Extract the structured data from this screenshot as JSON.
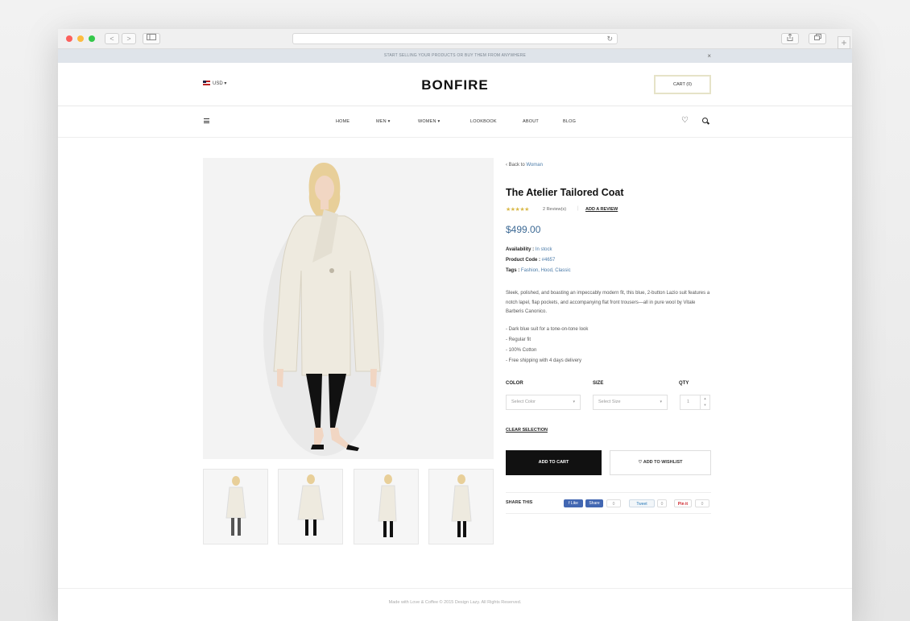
{
  "browser": {
    "buttons": [
      "<",
      ">"
    ]
  },
  "banner": {
    "text": "START SELLING YOUR PRODUCTS OR BUY THEM FROM ANYWHERE",
    "close": "×"
  },
  "header": {
    "currency": "USD",
    "logo": "BONFIRE",
    "cart": "CART (0)"
  },
  "nav": {
    "items": [
      "HOME",
      "MEN",
      "WOMEN",
      "LOOKBOOK",
      "ABOUT",
      "BLOG"
    ]
  },
  "product": {
    "breadcrumb_prefix": "‹ Back to ",
    "breadcrumb_link": "Woman",
    "title": "The Atelier Tailored Coat",
    "stars": "★★★★★",
    "reviews": "2 Review(s)",
    "separator": "|",
    "add_review": "ADD A REVIEW",
    "price": "$499.00",
    "availability_label": "Availability :",
    "availability_value": "In stock",
    "code_label": "Product Code :",
    "code_value": "#4657",
    "tags_label": "Tags :",
    "tags_value": "Fashion, Hood, Classic",
    "description": "Sleek, polished, and boasting an impeccably modern fit, this blue, 2-button Lazio suit features a notch lapel, flap pockets, and accompanying flat front trousers—all in pure wool by Vitale Barberis Canonico.",
    "bullets": [
      "-  Dark blue suit for a tone-on-tone look",
      "-  Regular fit",
      "-  100% Cotton",
      "-  Free shipping with 4 days delivery"
    ],
    "color_label": "COLOR",
    "size_label": "SIZE",
    "qty_label": "QTY",
    "color_placeholder": "Select Color",
    "size_placeholder": "Select Size",
    "qty_value": "1",
    "clear_selection": "CLEAR SELECTION",
    "add_to_cart": "ADD TO CART",
    "add_to_wishlist": "ADD TO WISHLIST",
    "share_label": "SHARE THIS",
    "share": {
      "like": "f Like",
      "fb_share": "Share",
      "fb_count": "0",
      "tweet": "Tweet",
      "tw_count": "0",
      "pin": "Pin it",
      "pin_count": "0"
    }
  },
  "footer": {
    "text": "Made with Love & Coffee © 2015 Design Lazy. All Rights Reserved."
  }
}
